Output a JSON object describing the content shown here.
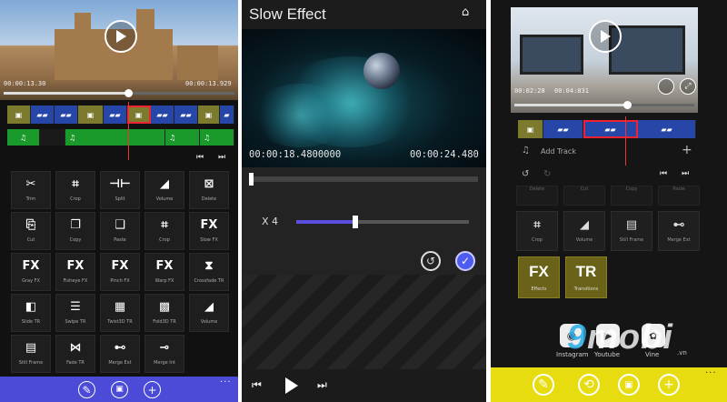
{
  "panel1": {
    "timecode_start": "00:00:13.30",
    "timecode_end": "00:00:13.929",
    "scrub_progress": 0.54,
    "tiles": [
      {
        "label": "Trim",
        "icon": "scissors-icon",
        "glyph": "✂"
      },
      {
        "label": "Crop",
        "icon": "crop-icon",
        "glyph": "⌗"
      },
      {
        "label": "Split",
        "icon": "split-icon",
        "glyph": "⊣⊢"
      },
      {
        "label": "Volume",
        "icon": "volume-icon",
        "glyph": "◢"
      },
      {
        "label": "Delete",
        "icon": "delete-icon",
        "glyph": "⊠"
      },
      {
        "label": "Cut",
        "icon": "cut-icon",
        "glyph": "⎘"
      },
      {
        "label": "Copy",
        "icon": "copy-icon",
        "glyph": "❐"
      },
      {
        "label": "Paste",
        "icon": "paste-icon",
        "glyph": "❏"
      },
      {
        "label": "Crop",
        "icon": "crop-icon",
        "glyph": "⌗"
      },
      {
        "label": "Slow FX",
        "icon": "fx-icon",
        "glyph": "FX"
      },
      {
        "label": "Gray FX",
        "icon": "fx-icon",
        "glyph": "FX"
      },
      {
        "label": "Fisheye FX",
        "icon": "fx-icon",
        "glyph": "FX"
      },
      {
        "label": "Pinch FX",
        "icon": "fx-icon",
        "glyph": "FX"
      },
      {
        "label": "Warp FX",
        "icon": "fx-icon",
        "glyph": "FX"
      },
      {
        "label": "Crossfade TR",
        "icon": "hourglass-icon",
        "glyph": "⧗"
      },
      {
        "label": "Slide TR",
        "icon": "slide-icon",
        "glyph": "◧"
      },
      {
        "label": "Swipe TR",
        "icon": "swipe-icon",
        "glyph": "☰"
      },
      {
        "label": "Twist3D TR",
        "icon": "twist-icon",
        "glyph": "▦"
      },
      {
        "label": "Fold3D TR",
        "icon": "fold-icon",
        "glyph": "▩"
      },
      {
        "label": "Volume",
        "icon": "volume-icon",
        "glyph": "◢"
      },
      {
        "label": "Still Frame",
        "icon": "film-icon",
        "glyph": "▤"
      },
      {
        "label": "Fade TR",
        "icon": "fade-icon",
        "glyph": "⋈"
      },
      {
        "label": "Merge Ext",
        "icon": "merge-icon",
        "glyph": "⊷"
      },
      {
        "label": "Merge Int",
        "icon": "merge-icon",
        "glyph": "⊸"
      }
    ],
    "appbar": {
      "more": "..."
    }
  },
  "panel2": {
    "title": "Slow Effect",
    "timecode_current": "00:00:18.4800000",
    "timecode_total": "00:00:24.480",
    "speed_label": "X 4",
    "speed_level": 0.34,
    "trim_progress": 0.01
  },
  "panel3": {
    "timecode_start": "00:02:28",
    "timecode_end": "00:04:831",
    "add_track": "Add Track",
    "tiles_top_faded": [
      "Delete",
      "Cut",
      "Copy",
      "Paste"
    ],
    "tiles": [
      {
        "label": "Crop",
        "icon": "crop-icon",
        "glyph": "⌗"
      },
      {
        "label": "Volume",
        "icon": "volume-icon",
        "glyph": "◢"
      },
      {
        "label": "Still Frame",
        "icon": "film-icon",
        "glyph": "▤"
      },
      {
        "label": "Merge Ext",
        "icon": "merge-icon",
        "glyph": "⊷"
      }
    ],
    "fx_tiles": [
      {
        "label": "Effects",
        "glyph": "FX"
      },
      {
        "label": "Transitions",
        "glyph": "TR"
      }
    ],
    "social": [
      "Instagram",
      "Youtube",
      "Vine"
    ],
    "watermark": {
      "nine": "9",
      "rest": "mobi",
      "sub": ".vn"
    },
    "appbar": {
      "more": "..."
    }
  }
}
